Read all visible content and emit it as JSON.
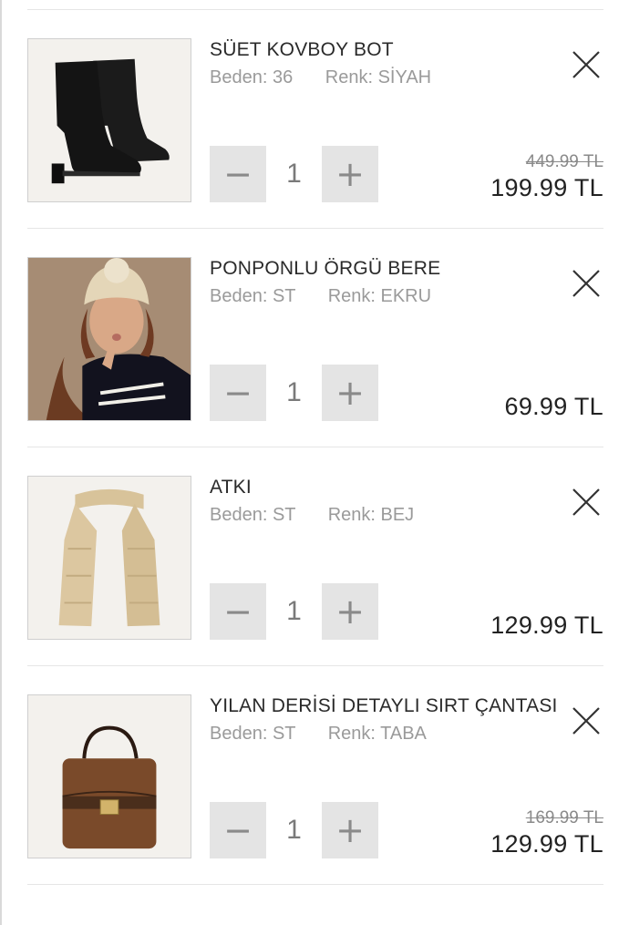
{
  "cart": {
    "items": [
      {
        "name": "SÜET KOVBOY BOT",
        "size": "Beden: 36",
        "color": "Renk: SİYAH",
        "quantity": "1",
        "old_price": "449.99 TL",
        "price": "199.99 TL",
        "image_icon": "black-suede-boot-image"
      },
      {
        "name": "PONPONLU ÖRGÜ BERE",
        "size": "Beden: ST",
        "color": "Renk: EKRU",
        "quantity": "1",
        "old_price": "",
        "price": "69.99 TL",
        "image_icon": "model-wearing-beanie-image"
      },
      {
        "name": "ATKI",
        "size": "Beden: ST",
        "color": "Renk: BEJ",
        "quantity": "1",
        "old_price": "",
        "price": "129.99 TL",
        "image_icon": "beige-knit-scarf-image"
      },
      {
        "name": "YILAN DERİSİ DETAYLI SIRT ÇANTASI",
        "size": "Beden: ST",
        "color": "Renk: TABA",
        "quantity": "1",
        "old_price": "169.99 TL",
        "price": "129.99 TL",
        "image_icon": "brown-backpack-image"
      }
    ],
    "controls": {
      "minus": "−",
      "plus": "+"
    }
  },
  "colors": {
    "stepper_bg": "#e4e4e4",
    "divider": "#e6e6e6",
    "muted_text": "#9a9a9a"
  }
}
